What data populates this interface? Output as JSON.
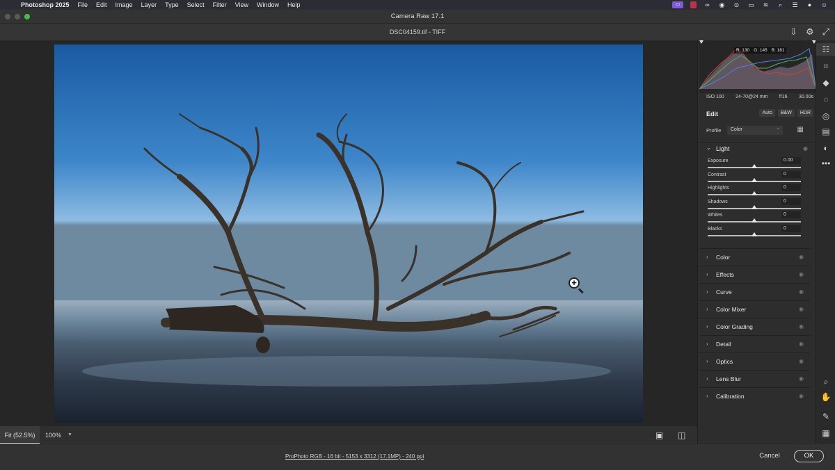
{
  "menubar": {
    "app_name": "Photoshop 2025",
    "items": [
      "File",
      "Edit",
      "Image",
      "Layer",
      "Type",
      "Select",
      "Filter",
      "View",
      "Window",
      "Help"
    ]
  },
  "window": {
    "title": "Camera Raw 17.1"
  },
  "file": {
    "name": "DSC04159.tif",
    "separator": " - ",
    "format": "TIFF"
  },
  "histogram": {
    "r": "R: 130",
    "g": "G: 145",
    "b": "B: 181"
  },
  "exif": {
    "iso": "ISO 100",
    "lens": "24-70@24 mm",
    "aperture": "f/16",
    "shutter": "30.00s"
  },
  "edit": {
    "title": "Edit",
    "auto": "Auto",
    "bw": "B&W",
    "hdr": "HDR",
    "profile_label": "Profile",
    "profile_value": "Color"
  },
  "light": {
    "label": "Light",
    "sliders": [
      {
        "name": "Exposure",
        "value": "0.00"
      },
      {
        "name": "Contrast",
        "value": "0"
      },
      {
        "name": "Highlights",
        "value": "0"
      },
      {
        "name": "Shadows",
        "value": "0"
      },
      {
        "name": "Whites",
        "value": "0"
      },
      {
        "name": "Blacks",
        "value": "0"
      }
    ]
  },
  "sections": [
    "Color",
    "Effects",
    "Curve",
    "Color Mixer",
    "Color Grading",
    "Detail",
    "Optics",
    "Lens Blur",
    "Calibration"
  ],
  "zoom": {
    "fit": "Fit (52.5%)",
    "pct": "100%"
  },
  "footer": {
    "workflow": "ProPhoto RGB - 16 bit - 5153 x 3312 (17.1MP) - 240 ppi",
    "cancel": "Cancel",
    "ok": "OK"
  },
  "icons": {
    "toolbar": [
      "sliders-icon",
      "crop-icon",
      "eraser-icon",
      "masking-icon",
      "redeye-icon",
      "presets-icon",
      "snapshots-icon",
      "more-icon",
      "zoom-icon",
      "hand-icon",
      "color-sampler-icon",
      "grid-icon"
    ]
  },
  "colors": {
    "sky_top": "#1d5fa8",
    "sky_horizon": "#8fbbe0",
    "accent_status": "#7c5cd6"
  }
}
